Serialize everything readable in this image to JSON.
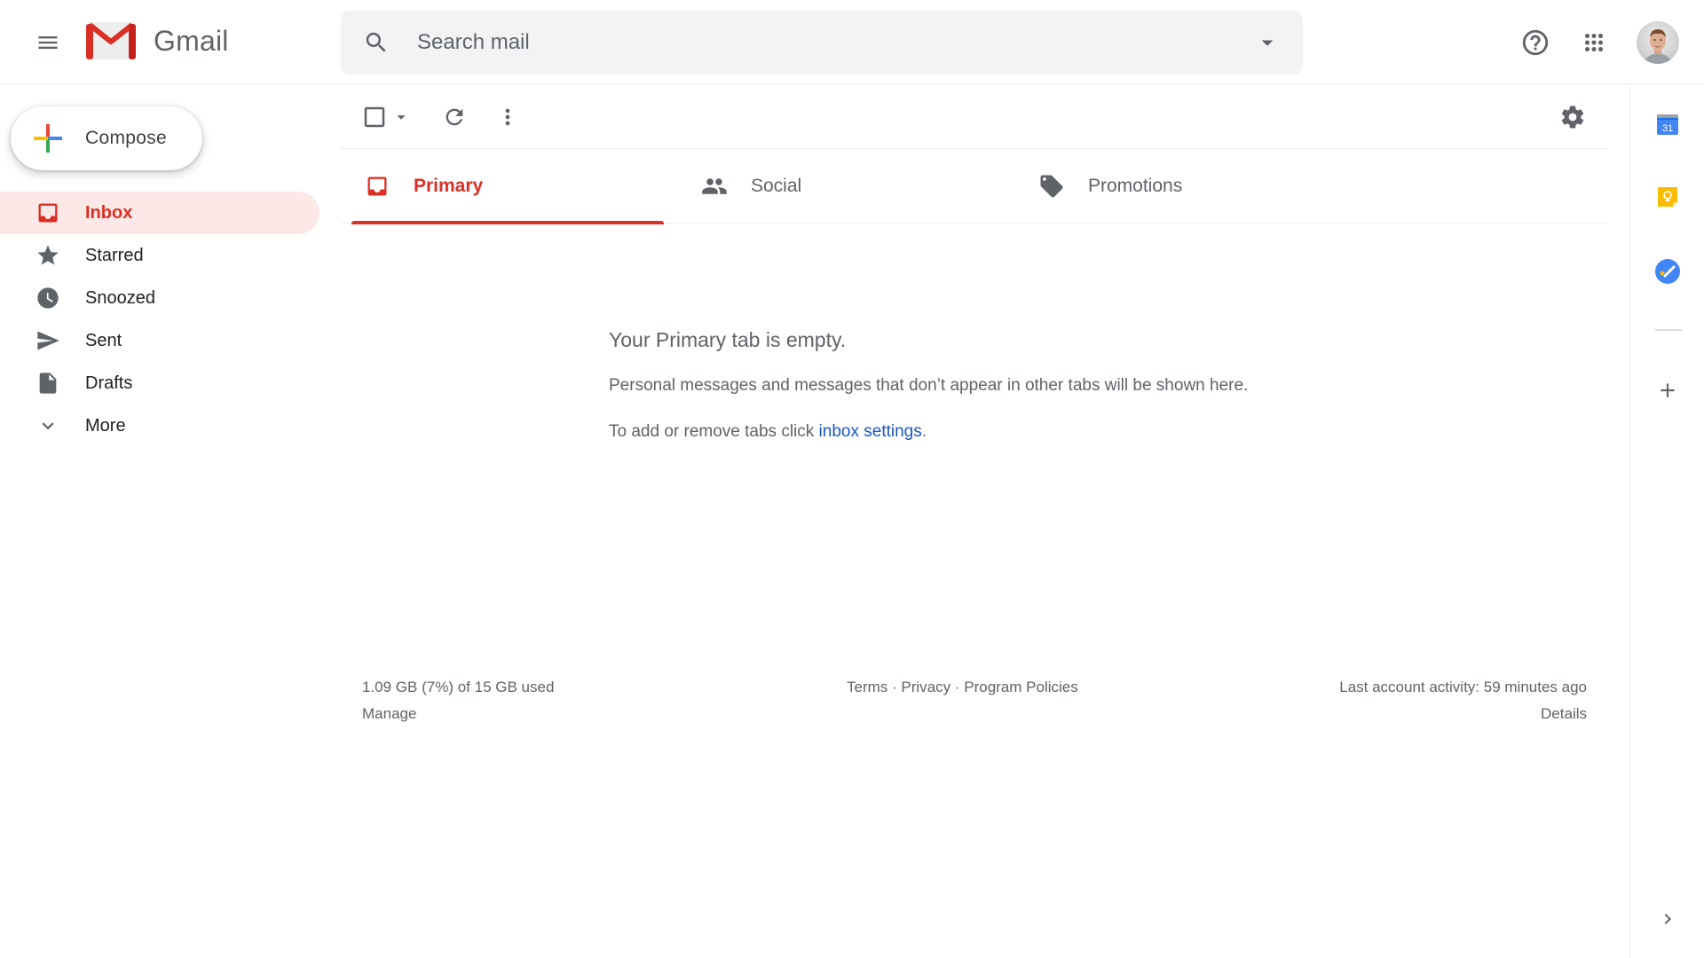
{
  "header": {
    "app_name": "Gmail",
    "search_placeholder": "Search mail",
    "icons": {
      "menu": "menu-icon",
      "search": "search-icon",
      "search_options": "arrow-drop-down-icon",
      "help": "help-icon",
      "apps": "apps-grid-icon",
      "account": "avatar"
    }
  },
  "sidebar": {
    "compose_label": "Compose",
    "items": [
      {
        "label": "Inbox",
        "icon": "inbox-icon",
        "active": true
      },
      {
        "label": "Starred",
        "icon": "star-icon",
        "active": false
      },
      {
        "label": "Snoozed",
        "icon": "clock-icon",
        "active": false
      },
      {
        "label": "Sent",
        "icon": "send-icon",
        "active": false
      },
      {
        "label": "Drafts",
        "icon": "draft-icon",
        "active": false
      },
      {
        "label": "More",
        "icon": "chevron-down-icon",
        "active": false
      }
    ]
  },
  "toolbar": {
    "select_all": "checkbox-icon",
    "select_menu": "arrow-drop-down-icon",
    "refresh": "refresh-icon",
    "more": "more-vert-icon",
    "settings": "gear-icon"
  },
  "tabs": [
    {
      "label": "Primary",
      "icon": "inbox-icon",
      "active": true
    },
    {
      "label": "Social",
      "icon": "people-icon",
      "active": false
    },
    {
      "label": "Promotions",
      "icon": "tag-icon",
      "active": false
    }
  ],
  "empty_state": {
    "title": "Your Primary tab is empty.",
    "description": "Personal messages and messages that don’t appear in other tabs will be shown here.",
    "hint_prefix": "To add or remove tabs click ",
    "hint_link": "inbox settings",
    "hint_suffix": "."
  },
  "footer": {
    "storage": "1.09 GB (7%) of 15 GB used",
    "manage": "Manage",
    "terms": "Terms",
    "privacy": "Privacy",
    "program_policies": "Program Policies",
    "separator": " · ",
    "last_activity": "Last account activity: 59 minutes ago",
    "details": "Details"
  },
  "side_panel": {
    "apps": [
      {
        "name": "Calendar",
        "icon": "calendar-icon",
        "text": "31"
      },
      {
        "name": "Keep",
        "icon": "keep-icon"
      },
      {
        "name": "Tasks",
        "icon": "tasks-icon"
      }
    ],
    "add": "add-icon",
    "expand": "chevron-right-icon"
  },
  "colors": {
    "accent_red": "#d93025",
    "active_bg": "#fce8e6",
    "link_blue": "#1a56c6",
    "icon_gray": "#5f6368",
    "search_bg": "#f1f3f4"
  }
}
